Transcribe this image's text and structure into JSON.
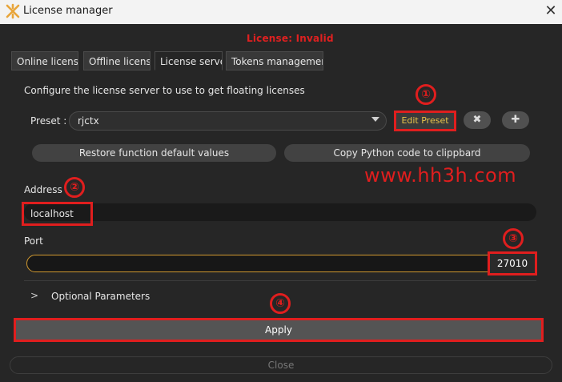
{
  "window": {
    "title": "License manager",
    "close_glyph": "✕",
    "app_icon": "app-logo-icon"
  },
  "status": "License: Invalid",
  "tabs": [
    {
      "label": "Online license",
      "active": false
    },
    {
      "label": "Offline license",
      "active": false
    },
    {
      "label": "License server",
      "active": true
    },
    {
      "label": "Tokens management",
      "active": false
    }
  ],
  "server": {
    "description": "Configure the license server to use to get floating licenses",
    "preset_label": "Preset :",
    "preset_value": "rjctx",
    "edit_preset": "Edit Preset",
    "delete_glyph": "✖",
    "add_glyph": "✚",
    "restore_defaults": "Restore function default values",
    "copy_python": "Copy Python code to clippbard",
    "address_label": "Address",
    "address_value": "localhost",
    "port_label": "Port",
    "port_value": "27010",
    "optional_arrow": ">",
    "optional_label": "Optional Parameters",
    "apply": "Apply",
    "close": "Close"
  },
  "annotations": {
    "watermark": "www.hh3h.com",
    "markers": [
      "①",
      "②",
      "③",
      "④"
    ],
    "color": "#e01e1e"
  }
}
